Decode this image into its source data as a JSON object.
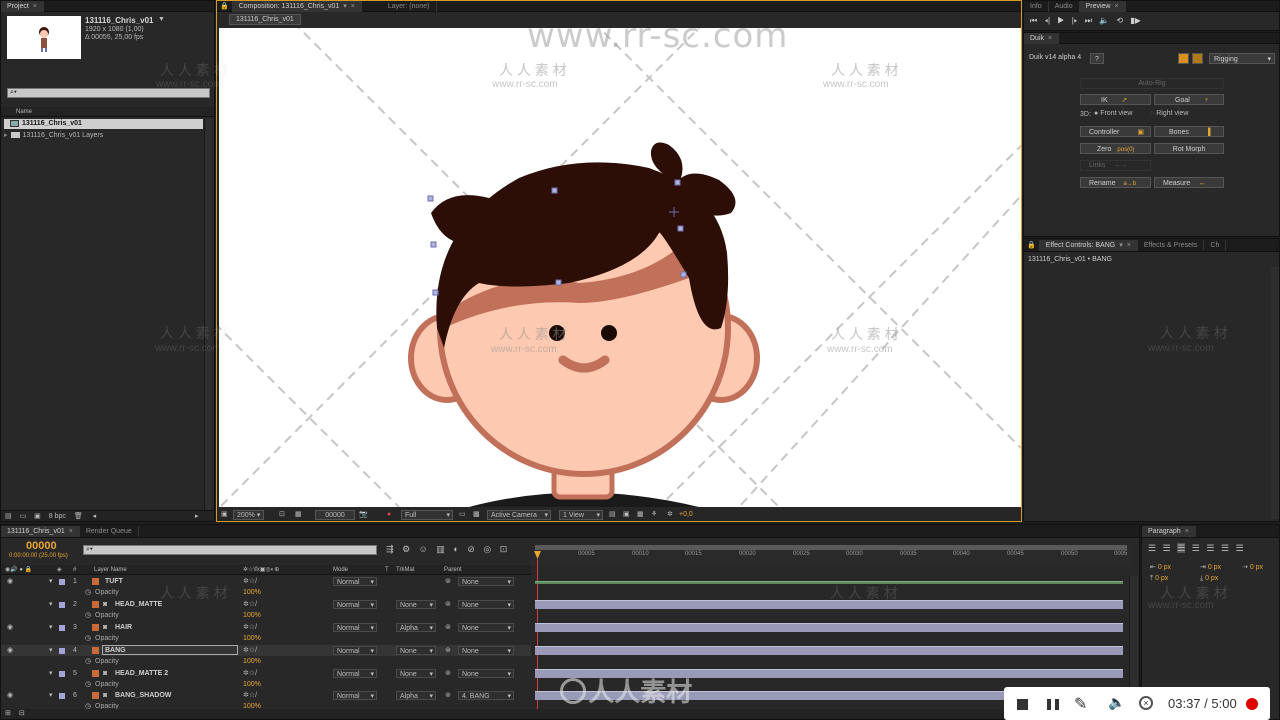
{
  "project_panel": {
    "tab": "Project",
    "comp_name": "131116_Chris_v01",
    "comp_res": "1920 x 1080 (1,00)",
    "comp_duration": "Δ 00055, 25,00 fps",
    "search_placeholder": "⌕▾",
    "column_name": "Name",
    "items": [
      {
        "label": "131116_Chris_v01"
      },
      {
        "label": "131116_Chris_v01 Layers"
      }
    ],
    "bpc": "8 bpc"
  },
  "comp_panel": {
    "tab": "Composition: 131116_Chris_v01",
    "layer_tab": "Layer: (none)",
    "sub_tab": "131116_Chris_v01",
    "zoom": "200%",
    "timecode": "00000",
    "resolution": "Full",
    "camera": "Active Camera",
    "views": "1 View",
    "exposure": "+0,0"
  },
  "right_top_tabs": [
    "Info",
    "Audio",
    "Preview"
  ],
  "duik": {
    "tab": "Duik",
    "version": "Duik v14 alpha 4",
    "help": "?",
    "mode": "Rigging",
    "autorig": "Auto-Rig",
    "ik": "IK",
    "goal": "Goal",
    "label_3d": "3D:",
    "front_view": "Front view",
    "right_view": "Right view",
    "controller": "Controller",
    "bones": "Bones",
    "zero": "Zero",
    "zero_badge": "pos(0)",
    "rot_morph": "Rot Morph",
    "links": "Links",
    "rename": "Rename",
    "rename_badge": "a→b",
    "measure": "Measure"
  },
  "effect_controls": {
    "tab": "Effect Controls: BANG",
    "tab2": "Effects & Presets",
    "tab3": "Ch",
    "path": "131116_Chris_v01 • BANG"
  },
  "timeline": {
    "tab": "131116_Chris_v01",
    "render_tab": "Render Queue",
    "timecode": "00000",
    "timecode_sub": "0:00:00:00 (25.00 fps)",
    "col_layer_name": "Layer Name",
    "col_mode": "Mode",
    "col_t": "T",
    "col_trkmat": "TrkMat",
    "col_parent": "Parent",
    "ruler": [
      "00005",
      "00010",
      "00015",
      "00020",
      "00025",
      "00030",
      "00035",
      "00040",
      "00045",
      "00050",
      "0005"
    ],
    "opacity_label": "Opacity",
    "opacity_value": "100%",
    "layers": [
      {
        "num": "1",
        "name": "TUFT",
        "mode": "Normal",
        "trkmat": "",
        "parent": "None"
      },
      {
        "num": "2",
        "name": "HEAD_MATTE",
        "mode": "Normal",
        "trkmat": "None",
        "parent": "None"
      },
      {
        "num": "3",
        "name": "HAIR",
        "mode": "Normal",
        "trkmat": "Alpha",
        "parent": "None"
      },
      {
        "num": "4",
        "name": "BANG",
        "mode": "Normal",
        "trkmat": "None",
        "parent": "None"
      },
      {
        "num": "5",
        "name": "HEAD_MATTE 2",
        "mode": "Normal",
        "trkmat": "None",
        "parent": "None"
      },
      {
        "num": "6",
        "name": "BANG_SHADOW",
        "mode": "Normal",
        "trkmat": "Alpha",
        "parent": "4. BANG"
      }
    ]
  },
  "paragraph": {
    "tab": "Paragraph",
    "fields": [
      "0 px",
      "0 px",
      "0 px",
      "0 px",
      "0 px"
    ]
  },
  "watermarks": {
    "top_url": "www.rr-sc.com",
    "cn": "人 人 素 材",
    "url": "www.rr-sc.com",
    "logo_text": "人人素材"
  },
  "video_player": {
    "time": "03:37 / 5:00"
  },
  "colors": {
    "accent": "#e6a532",
    "hair": "#2d0e07",
    "skin": "#fdc9b1",
    "skin_outline": "#c1705a",
    "record": "#e00000"
  }
}
